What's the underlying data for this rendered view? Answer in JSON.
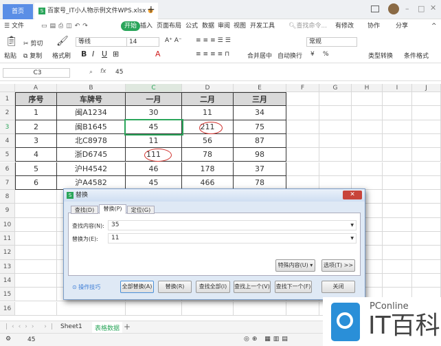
{
  "tabs": {
    "home": "首页",
    "doc": "百家号_IT小人物示例文件WPS.xlsx",
    "add": "+"
  },
  "menu": {
    "file": "文件",
    "start": "开始",
    "items": [
      "插入",
      "页面布局",
      "公式",
      "数据",
      "审阅",
      "视图",
      "开发工具"
    ],
    "search": "查找命令...",
    "modified": "有修改",
    "collab": "协作",
    "share": "分享"
  },
  "toolbar": {
    "paste": "粘贴",
    "cut": "剪切",
    "copy": "复制",
    "format_painter": "格式刷",
    "font": "等线",
    "size": "14",
    "bold": "B",
    "italic": "I",
    "underline": "U",
    "merge": "合并居中",
    "wrap": "自动换行",
    "number_format": "常规",
    "currency": "¥",
    "percent": "%",
    "convert": "类型转换",
    "cond_format": "条件格式"
  },
  "formula_bar": {
    "cell_ref": "C3",
    "fx": "fx",
    "value": "45"
  },
  "sheet": {
    "columns": [
      "A",
      "B",
      "C",
      "D",
      "E",
      "F",
      "G",
      "H",
      "I",
      "J"
    ],
    "rows": [
      "1",
      "2",
      "3",
      "4",
      "5",
      "6",
      "7",
      "8",
      "9",
      "10",
      "11",
      "12",
      "13",
      "14",
      "15",
      "16"
    ],
    "headers": [
      "序号",
      "车牌号",
      "一月",
      "二月",
      "三月"
    ],
    "data": [
      [
        "1",
        "闽A1234",
        "30",
        "11",
        "34"
      ],
      [
        "2",
        "闽B1645",
        "45",
        "211",
        "75"
      ],
      [
        "3",
        "北C8978",
        "11",
        "56",
        "87"
      ],
      [
        "4",
        "浙D6745",
        "111",
        "78",
        "98"
      ],
      [
        "5",
        "沪H4542",
        "46",
        "178",
        "37"
      ],
      [
        "6",
        "沪A4582",
        "45",
        "466",
        "78"
      ]
    ],
    "selected": "C3"
  },
  "dialog": {
    "title": "替换",
    "tabs": [
      "查找(D)",
      "替换(P)",
      "定位(G)"
    ],
    "active_tab": 1,
    "find_label": "查找内容(N):",
    "find_value": "35",
    "replace_label": "替换为(E):",
    "replace_value": "11",
    "special": "特殊内容(U)",
    "options": "选项(T) >>",
    "tips": "操作技巧",
    "buttons": [
      "全部替换(A)",
      "替换(R)",
      "查找全部(I)",
      "查找上一个(V)",
      "查找下一个(F)",
      "关闭"
    ]
  },
  "sheet_tabs": [
    "Sheet1",
    "表格数据"
  ],
  "status": {
    "value": "45"
  },
  "watermark": {
    "brand": "PConline",
    "name": "IT百科"
  },
  "colors": {
    "accent": "#2aa55a",
    "selection": "#2aa55a",
    "circle": "#d0302c"
  }
}
